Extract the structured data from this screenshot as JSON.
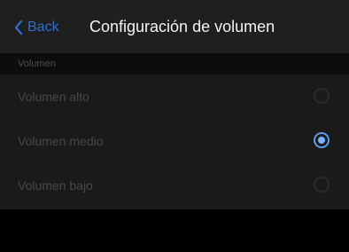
{
  "nav": {
    "back_label": "Back",
    "title": "Configuración de volumen"
  },
  "section": {
    "header": "Volumen"
  },
  "options": [
    {
      "label": "Volumen alto",
      "selected": false
    },
    {
      "label": "Volumen medio",
      "selected": true
    },
    {
      "label": "Volumen bajo",
      "selected": false
    }
  ],
  "colors": {
    "accent": "#2f6fd0",
    "radio_selected": "#5b9bef",
    "nav_background": "#1f1f1f",
    "list_background": "#1a1a1a"
  },
  "icons": {
    "back": "chevron-left-icon",
    "radio_on": "radio-selected-icon",
    "radio_off": "radio-unselected-icon"
  }
}
